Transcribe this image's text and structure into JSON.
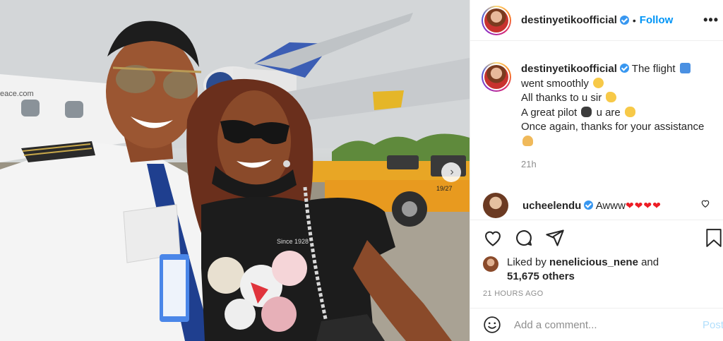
{
  "post": {
    "photo_caption_hidden": "",
    "sticker_text": "eace.com",
    "truck_label": "19/27",
    "shirt_text": "Since 1928"
  },
  "header": {
    "username": "destinyetikoofficial",
    "separator": "•",
    "follow_label": "Follow",
    "more_label": "•••"
  },
  "caption": {
    "username": "destinyetikoofficial",
    "lines": [
      "The flight",
      "went smoothly",
      "All thanks to u sir",
      "A great pilot",
      "u are",
      "Once again, thanks for your assistance"
    ],
    "time": "21h"
  },
  "comment": {
    "username": "ucheelendu",
    "text": "Awww",
    "hearts": "❤❤❤❤"
  },
  "likes": {
    "prefix": "Liked by ",
    "user": "nenelicious_nene",
    "suffix": " and",
    "others": "51,675 others"
  },
  "timestamp": "21 HOURS AGO",
  "add_comment": {
    "placeholder": "Add a comment...",
    "post_label": "Post"
  },
  "icons": {
    "like": "heart-icon",
    "comment": "comment-icon",
    "share": "share-icon",
    "save": "bookmark-icon",
    "emoji": "emoji-icon",
    "carousel_next": "chevron-right-icon"
  },
  "colors": {
    "link_blue": "#0095f6",
    "verified_blue": "#3897f0",
    "muted": "#8e8e8e",
    "post_disabled": "#b2dffc"
  }
}
